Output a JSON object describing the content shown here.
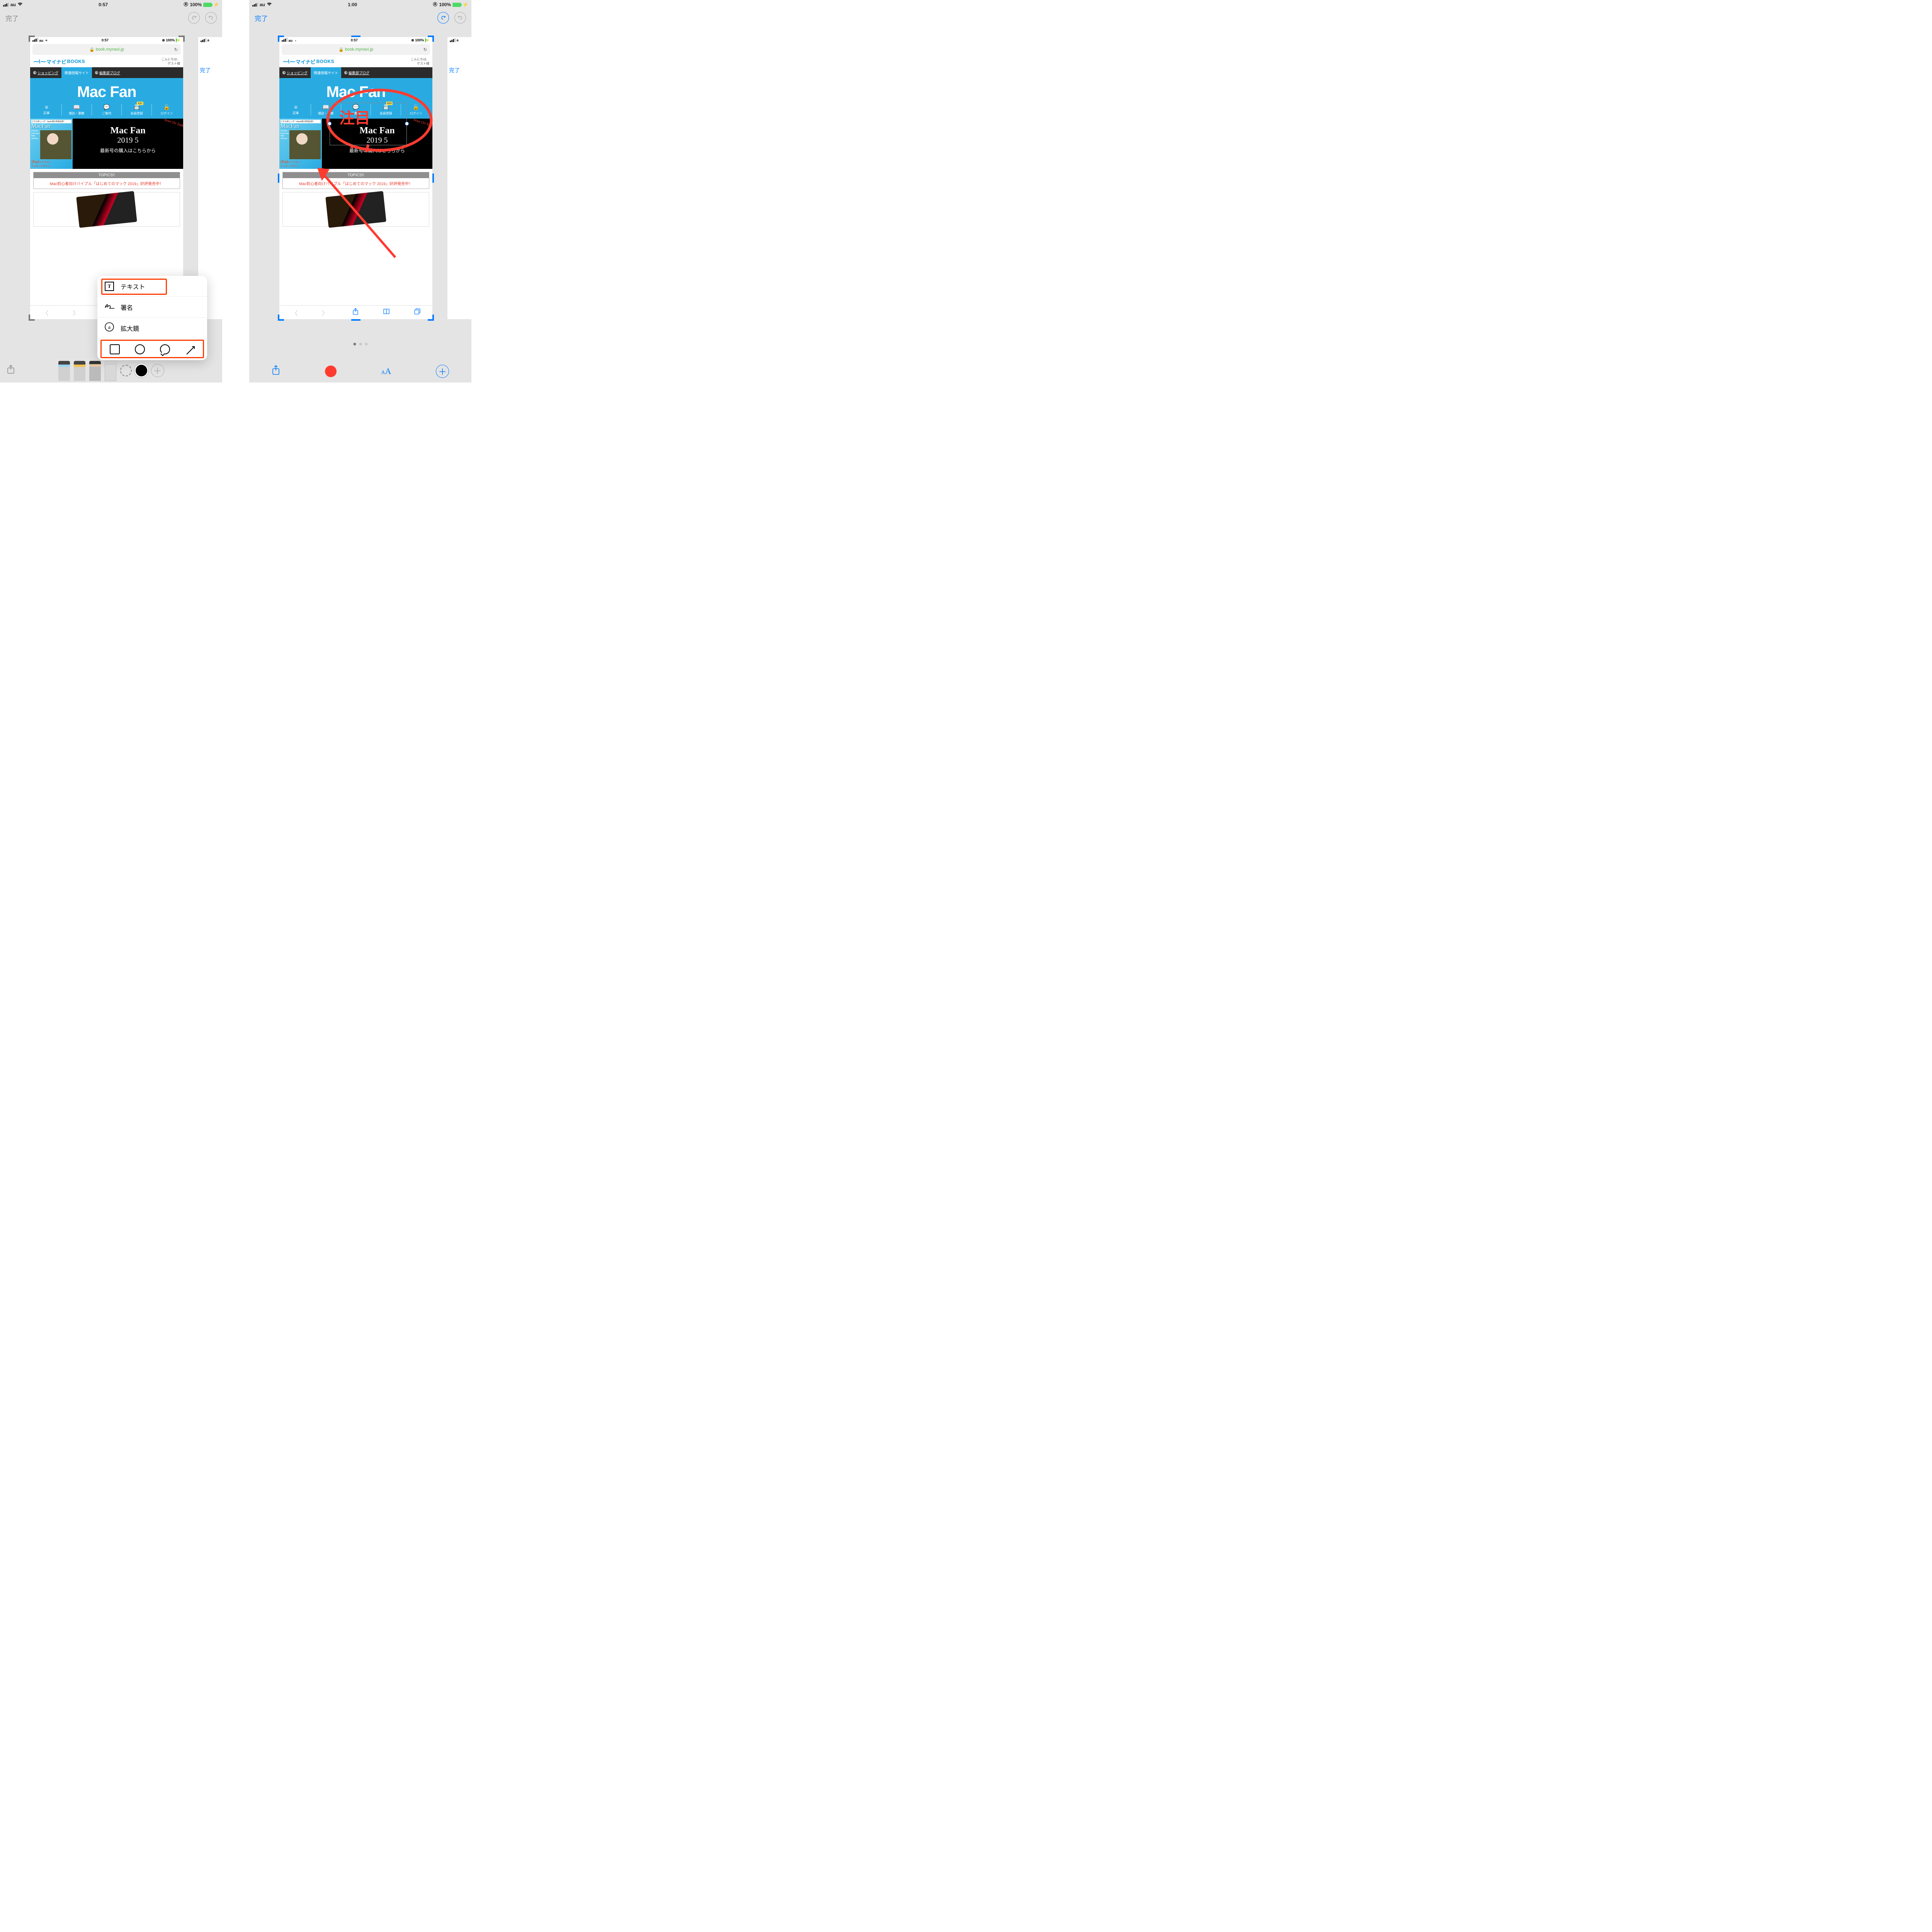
{
  "left": {
    "status": {
      "carrier": "au",
      "time": "0:57",
      "battery_pct": "100%"
    },
    "markup": {
      "done": "完了"
    },
    "popover": {
      "text": "テキスト",
      "signature": "署名",
      "magnifier": "拡大鏡"
    }
  },
  "right": {
    "status": {
      "carrier": "au",
      "time": "1:00",
      "battery_pct": "100%"
    },
    "markup": {
      "done": "完了",
      "font_control": "AA"
    },
    "annotation_text": "注目"
  },
  "screenshot": {
    "status": {
      "carrier": "au",
      "time": "0:57",
      "battery_pct": "100%"
    },
    "url": "book.mynavi.jp",
    "logo_brand": "マイナビ",
    "logo_sub": "BOOKS",
    "greeting_l1": "こんにちは、",
    "greeting_l2": "ゲスト様",
    "nav": {
      "shopping": "ショッピング",
      "related": "関連情報サイト",
      "blog": "編集部ブログ"
    },
    "banner_title": "Mac Fan",
    "menu": {
      "articles": "記事",
      "mags": "雑誌・書籍",
      "guide": "ご案内",
      "register": "会員登録",
      "login": "ログイン",
      "paid_badge": "有料"
    },
    "promo": {
      "onsale": "Now On Sale!",
      "line1": "Mac Fan",
      "line2": "2019 5",
      "line3": "最新号の購入はこちらから",
      "mag_top": "どれも欲しいぞ！Apple春の新製品祭！",
      "mag_logo": "MacFan",
      "mag_specs": "iPad Air\niPad mini\niMac\nAirPods",
      "mag_ipad": "iPad",
      "mag_ipad_sub1": "でイラスト・",
      "mag_ipad_sub2": "マンガ・デザイン"
    },
    "topics": {
      "header": "TOPICS!!",
      "body": "Mac初心者向けバイブル「はじめてのマック 2019」好評発売中！"
    }
  },
  "peek_done": "完了"
}
